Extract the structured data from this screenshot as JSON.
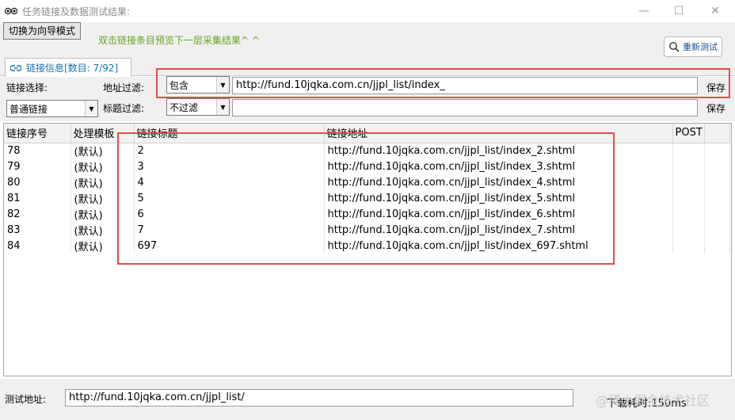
{
  "window": {
    "title": "任务链接及数据测试结果:",
    "minimize_glyph": "—",
    "maximize_glyph": "☐",
    "close_glyph": "✕"
  },
  "toolbar": {
    "guide_button": "切换为向导模式",
    "hint": "双击链接条目预览下一层采集结果^ ^",
    "retest_button": "重新测试",
    "retest_icon": "search-icon"
  },
  "tab": {
    "label": "链接信息[数目: 7/92]",
    "icon": "link-icon"
  },
  "filters": {
    "link_select_label": "链接选择:",
    "link_type_value": "普通链接",
    "address_filter_label": "地址过滤:",
    "address_filter_mode": "包含",
    "address_filter_value": "http://fund.10jqka.com.cn/jjpl_list/index_",
    "title_filter_label": "标题过滤:",
    "title_filter_mode": "不过滤",
    "title_filter_value": "",
    "save_label": "保存"
  },
  "grid": {
    "columns": [
      "链接序号",
      "处理模板",
      "链接标题",
      "链接地址",
      "POST"
    ],
    "rows": [
      [
        "78",
        "(默认)",
        "2",
        "http://fund.10jqka.com.cn/jjpl_list/index_2.shtml",
        ""
      ],
      [
        "79",
        "(默认)",
        "3",
        "http://fund.10jqka.com.cn/jjpl_list/index_3.shtml",
        ""
      ],
      [
        "80",
        "(默认)",
        "4",
        "http://fund.10jqka.com.cn/jjpl_list/index_4.shtml",
        ""
      ],
      [
        "81",
        "(默认)",
        "5",
        "http://fund.10jqka.com.cn/jjpl_list/index_5.shtml",
        ""
      ],
      [
        "82",
        "(默认)",
        "6",
        "http://fund.10jqka.com.cn/jjpl_list/index_6.shtml",
        ""
      ],
      [
        "83",
        "(默认)",
        "7",
        "http://fund.10jqka.com.cn/jjpl_list/index_7.shtml",
        ""
      ],
      [
        "84",
        "(默认)",
        "697",
        "http://fund.10jqka.com.cn/jjpl_list/index_697.shtml",
        ""
      ]
    ]
  },
  "status": {
    "test_address_label": "测试地址:",
    "test_address_value": "http://fund.10jqka.com.cn/jjpl_list/",
    "download_time": "下载耗时:150ms",
    "watermark": "@稀土掘金技术社区"
  },
  "colors": {
    "highlight_box": "#e64b4b",
    "hint_text": "#6aa220",
    "tab_text": "#1673b3"
  }
}
